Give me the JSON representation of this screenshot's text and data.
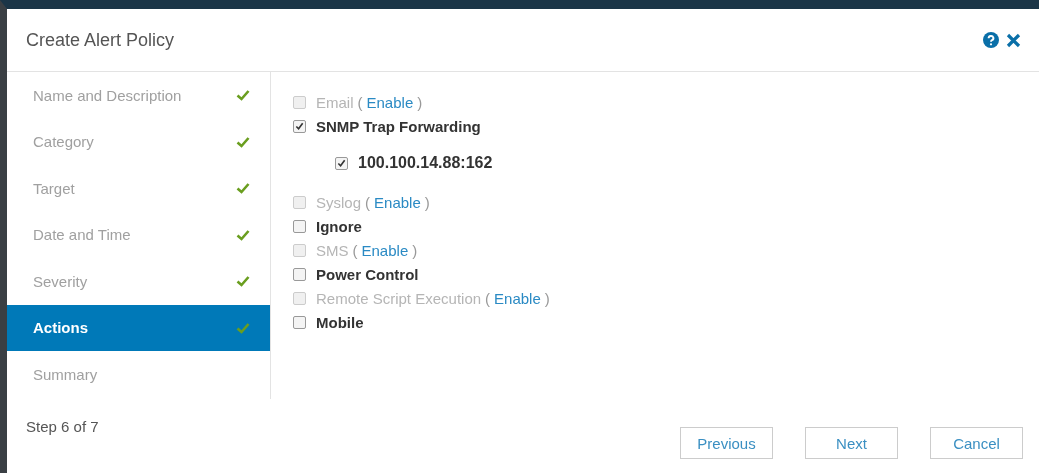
{
  "dialog": {
    "title": "Create Alert Policy"
  },
  "steps": [
    {
      "label": "Name and Description",
      "done": true,
      "selected": false
    },
    {
      "label": "Category",
      "done": true,
      "selected": false
    },
    {
      "label": "Target",
      "done": true,
      "selected": false
    },
    {
      "label": "Date and Time",
      "done": true,
      "selected": false
    },
    {
      "label": "Severity",
      "done": true,
      "selected": false
    },
    {
      "label": "Actions",
      "done": true,
      "selected": true
    },
    {
      "label": "Summary",
      "done": false,
      "selected": false
    }
  ],
  "actions": [
    {
      "label": "Email",
      "checked": false,
      "disabled": true,
      "link_open": "(",
      "link": "Enable",
      "link_close": ")"
    },
    {
      "label": "SNMP Trap Forwarding",
      "checked": true,
      "disabled": false,
      "children": [
        {
          "label": "100.100.14.88:162",
          "checked": true,
          "disabled": false
        }
      ]
    },
    {
      "label": "Syslog",
      "checked": false,
      "disabled": true,
      "link_open": "(",
      "link": "Enable",
      "link_close": ")"
    },
    {
      "label": "Ignore",
      "checked": false,
      "disabled": false
    },
    {
      "label": "SMS",
      "checked": false,
      "disabled": true,
      "link_open": "(",
      "link": "Enable",
      "link_close": ")"
    },
    {
      "label": "Power Control",
      "checked": false,
      "disabled": false
    },
    {
      "label": "Remote Script Execution",
      "checked": false,
      "disabled": true,
      "link_open": "(",
      "link": "Enable",
      "link_close": ")"
    },
    {
      "label": "Mobile",
      "checked": false,
      "disabled": false
    }
  ],
  "step_counter": "Step 6 of 7",
  "buttons": [
    "Previous",
    "Next",
    "Cancel"
  ]
}
